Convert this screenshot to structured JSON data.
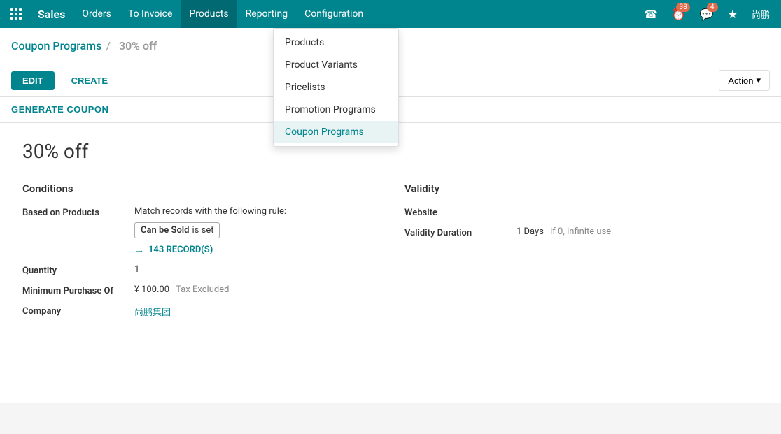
{
  "app": {
    "name": "Sales"
  },
  "navbar": {
    "menus": [
      {
        "id": "orders",
        "label": "Orders",
        "has_dropdown": true
      },
      {
        "id": "to_invoice",
        "label": "To Invoice",
        "has_dropdown": true
      },
      {
        "id": "products",
        "label": "Products",
        "has_dropdown": true,
        "active": true
      },
      {
        "id": "reporting",
        "label": "Reporting",
        "has_dropdown": true
      },
      {
        "id": "configuration",
        "label": "Configuration",
        "has_dropdown": true
      }
    ],
    "right_items": [
      {
        "id": "phone",
        "icon": "☎",
        "badge": null
      },
      {
        "id": "activity",
        "icon": "⏰",
        "badge": "38"
      },
      {
        "id": "messages",
        "icon": "💬",
        "badge": "4"
      },
      {
        "id": "starred",
        "icon": "★",
        "badge": null
      }
    ],
    "username": "尚鹏"
  },
  "products_dropdown": {
    "items": [
      {
        "id": "products",
        "label": "Products",
        "selected": false
      },
      {
        "id": "product_variants",
        "label": "Product Variants",
        "selected": false
      },
      {
        "id": "pricelists",
        "label": "Pricelists",
        "selected": false
      },
      {
        "id": "promotion_programs",
        "label": "Promotion Programs",
        "selected": false
      },
      {
        "id": "coupon_programs",
        "label": "Coupon Programs",
        "selected": true
      }
    ]
  },
  "breadcrumb": {
    "parent_label": "Coupon Programs",
    "separator": "/",
    "current": "30% off"
  },
  "toolbar": {
    "edit_label": "EDIT",
    "create_label": "CREATE",
    "action_label": "Action",
    "generate_coupon_label": "GENERATE COUPON"
  },
  "record": {
    "title": "30% off",
    "conditions_title": "Conditions",
    "based_on_label": "Based on Products",
    "filter_tag_field": "Can be Sold",
    "filter_tag_operator": "is set",
    "records_link": "143 RECORD(S)",
    "quantity_label": "Quantity",
    "quantity_value": "1",
    "min_purchase_label": "Minimum Purchase Of",
    "min_purchase_value": "¥ 100.00",
    "min_purchase_suffix": "Tax Excluded",
    "company_label": "Company",
    "company_value": "尚鹏集团",
    "validity_title": "Validity",
    "website_label": "Website",
    "website_value": "",
    "validity_duration_label": "Validity Duration",
    "validity_duration_value": "1 Days",
    "validity_duration_suffix": "if 0, infinite use"
  }
}
